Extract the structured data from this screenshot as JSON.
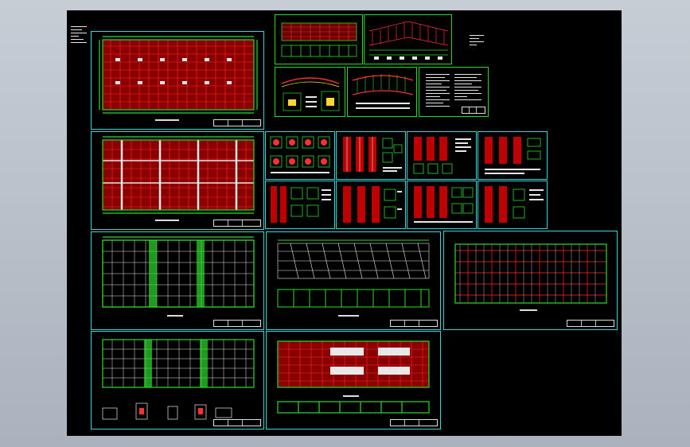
{
  "viewer": {
    "background_color": "#b4bcc6",
    "canvas_color": "#000000",
    "frame_color_cyan": "#38d7d7",
    "frame_color_green": "#2bd82b",
    "line_color_green": "#1fd31f",
    "line_color_red": "#ff2020",
    "line_color_white": "#e8e8e8"
  },
  "sheets": [
    {
      "id": "s01",
      "kind": "roof-plan"
    },
    {
      "id": "s02",
      "kind": "section-long"
    },
    {
      "id": "s03",
      "kind": "section-detail"
    },
    {
      "id": "s04",
      "kind": "elevation"
    },
    {
      "id": "s05",
      "kind": "elevation"
    },
    {
      "id": "s06",
      "kind": "notes"
    },
    {
      "id": "s07",
      "kind": "column-plan"
    },
    {
      "id": "s08",
      "kind": "details"
    },
    {
      "id": "s09",
      "kind": "column-details"
    },
    {
      "id": "s10",
      "kind": "column-details"
    },
    {
      "id": "s11",
      "kind": "column-details"
    },
    {
      "id": "s12",
      "kind": "details"
    },
    {
      "id": "s13",
      "kind": "column-details"
    },
    {
      "id": "s14",
      "kind": "column-details"
    },
    {
      "id": "s15",
      "kind": "column-details"
    },
    {
      "id": "s16",
      "kind": "beam-plan"
    },
    {
      "id": "s17",
      "kind": "truss-plan"
    },
    {
      "id": "s18",
      "kind": "purlin-plan"
    },
    {
      "id": "s19",
      "kind": "bracing-plan"
    },
    {
      "id": "s20",
      "kind": "foundation-plan"
    }
  ]
}
